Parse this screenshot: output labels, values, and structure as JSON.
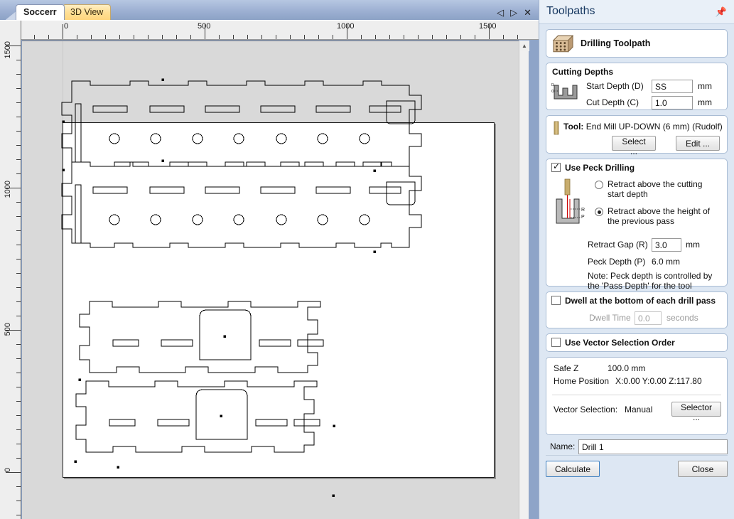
{
  "document": {
    "tabs": [
      {
        "label": "Soccerr",
        "active": true
      },
      {
        "label": "3D View",
        "active": false
      }
    ],
    "window_controls": [
      "◁",
      "▷",
      "✕"
    ],
    "ruler": {
      "horizontal_labels": [
        "0",
        "500",
        "1000",
        "1500"
      ],
      "vertical_labels": [
        "1500",
        "1000",
        "500",
        "0"
      ],
      "units": "mm"
    }
  },
  "panel": {
    "title": "Toolpaths",
    "pin_icon": "pin-icon",
    "toolpath": {
      "icon": "drilling-toolpath-icon",
      "label": "Drilling Toolpath"
    },
    "cutting_depths": {
      "title": "Cutting Depths",
      "icon": "depth-profile-icon",
      "start_depth_label": "Start Depth (D)",
      "start_depth_value": "SS",
      "start_depth_unit": "mm",
      "cut_depth_label": "Cut Depth (C)",
      "cut_depth_value": "1.0",
      "cut_depth_unit": "mm"
    },
    "tool": {
      "icon": "end-mill-icon",
      "label": "Tool:",
      "value": "End Mill UP-DOWN (6 mm) (Rudolf)",
      "select_button": "Select ...",
      "edit_button": "Edit ..."
    },
    "peck_drilling": {
      "checkbox_label": "Use Peck Drilling",
      "checked": true,
      "icon": "peck-drill-diagram-icon",
      "options": [
        {
          "label": "Retract above the cutting start depth",
          "selected": false
        },
        {
          "label": "Retract above the height of the previous pass",
          "selected": true
        }
      ],
      "retract_gap_label": "Retract Gap (R)",
      "retract_gap_value": "3.0",
      "retract_gap_unit": "mm",
      "peck_depth_label": "Peck Depth (P)",
      "peck_depth_value": "6.0 mm",
      "note": "Note: Peck depth is controlled by the 'Pass Depth' for the tool"
    },
    "dwell": {
      "checkbox_label": "Dwell at the bottom of each drill pass",
      "checked": false,
      "time_label": "Dwell Time",
      "time_value": "0.0",
      "time_unit": "seconds"
    },
    "vector_order": {
      "checkbox_label": "Use Vector Selection Order",
      "checked": false
    },
    "info": {
      "safe_z_label": "Safe Z",
      "safe_z_value": "100.0 mm",
      "home_label": "Home Position",
      "home_value": "X:0.00 Y:0.00 Z:117.80",
      "vector_selection_label": "Vector Selection:",
      "vector_selection_value": "Manual",
      "selector_button": "Selector ..."
    },
    "name": {
      "label": "Name:",
      "value": "Drill 1"
    },
    "footer": {
      "calculate_button": "Calculate",
      "close_button": "Close"
    }
  },
  "colors": {
    "panel_bg": "#dde7f3",
    "accent_tab": "#ffd67e",
    "canvas_bg": "#d9d9d9",
    "worksheet": "#ffffff",
    "vector_stroke": "#000000",
    "chrome": "#8ea4c8"
  }
}
